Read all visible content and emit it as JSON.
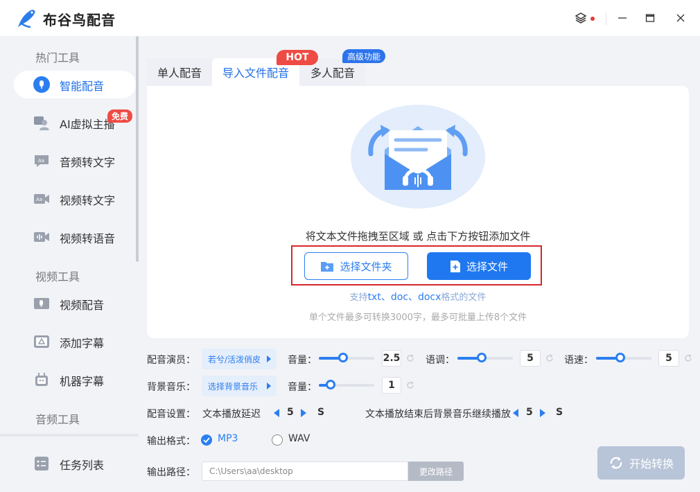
{
  "app": {
    "title": "布谷鸟配音"
  },
  "sidebar": {
    "sections": [
      {
        "title": "热门工具"
      },
      {
        "title": "视频工具"
      },
      {
        "title": "音频工具"
      }
    ],
    "items": [
      {
        "label": "智能配音",
        "icon": "mic-icon"
      },
      {
        "label": "AI虚拟主播",
        "icon": "avatar-icon",
        "badge": "免费"
      },
      {
        "label": "音频转文字",
        "icon": "audio-text-icon"
      },
      {
        "label": "视频转文字",
        "icon": "video-text-icon"
      },
      {
        "label": "视频转语音",
        "icon": "video-voice-icon"
      },
      {
        "label": "视频配音",
        "icon": "video-dub-icon"
      },
      {
        "label": "添加字幕",
        "icon": "subtitle-icon"
      },
      {
        "label": "机器字幕",
        "icon": "robot-icon"
      }
    ],
    "task_list": "任务列表"
  },
  "tabs": [
    {
      "label": "单人配音"
    },
    {
      "label": "导入文件配音",
      "badge": "HOT"
    },
    {
      "label": "多人配音",
      "badge": "高级功能"
    }
  ],
  "dropzone": {
    "hint": "将文本文件拖拽至区域 或 点击下方按钮添加文件",
    "folder_button": "选择文件夹",
    "file_button": "选择文件",
    "support_prefix": "支持",
    "fmt1": "txt",
    "sep1": "、",
    "fmt2": "doc",
    "sep2": "、",
    "fmt3": "docx",
    "support_suffix": "格式的文件",
    "limit": "单个文件最多可转换3000字，最多可批量上传8个文件"
  },
  "settings": {
    "voice_label": "配音演员：",
    "voice_value": "若兮/活泼俏皮",
    "volume_label": "音量：",
    "volume_value": "2.5",
    "pitch_label": "语调：",
    "pitch_value": "5",
    "speed_label": "语速：",
    "speed_value": "5",
    "bgm_label": "背景音乐：",
    "bgm_value": "选择背景音乐",
    "bgm_volume_label": "音量：",
    "bgm_volume_value": "1",
    "config_label": "配音设置：",
    "delay_label": "文本播放延迟",
    "delay_value": "5",
    "delay_unit": "S",
    "continue_label": "文本播放结束后背景音乐继续播放",
    "continue_value": "5",
    "continue_unit": "S",
    "format_label": "输出格式：",
    "format_mp3": "MP3",
    "format_wav": "WAV",
    "path_label": "输出路径：",
    "path_value": "C:\\Users\\aa\\desktop",
    "path_button": "更改路径"
  },
  "start_button": "开始转换",
  "colors": {
    "accent": "#1f78f0",
    "badge_red": "#ee4b44",
    "highlight": "#d7262b"
  }
}
